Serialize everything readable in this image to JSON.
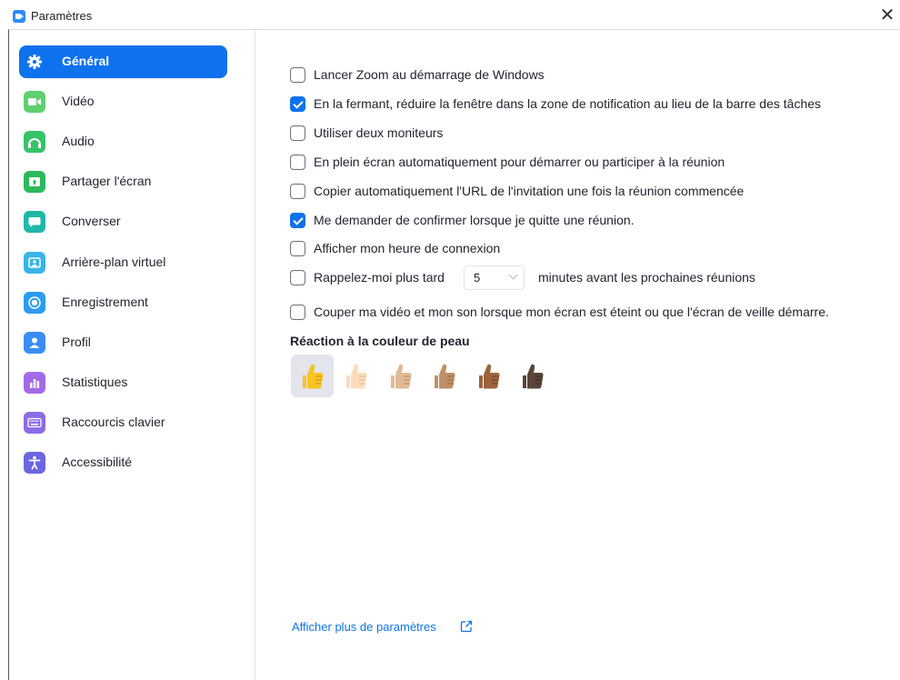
{
  "window": {
    "title": "Paramètres"
  },
  "sidebar": {
    "items": [
      {
        "label": "Général",
        "icon": "gear-icon",
        "color": "#0e72ed",
        "active": true
      },
      {
        "label": "Vidéo",
        "icon": "video-camera-icon",
        "color": "#5fcf70"
      },
      {
        "label": "Audio",
        "icon": "headphones-icon",
        "color": "#37c26a"
      },
      {
        "label": "Partager l'écran",
        "icon": "share-screen-icon",
        "color": "#2db85d"
      },
      {
        "label": "Converser",
        "icon": "chat-bubble-icon",
        "color": "#1fb8a8"
      },
      {
        "label": "Arrière-plan virtuel",
        "icon": "virtual-background-icon",
        "color": "#3ab4e8"
      },
      {
        "label": "Enregistrement",
        "icon": "record-icon",
        "color": "#2b9cf0"
      },
      {
        "label": "Profil",
        "icon": "profile-icon",
        "color": "#3a8df5"
      },
      {
        "label": "Statistiques",
        "icon": "statistics-icon",
        "color": "#a46be8"
      },
      {
        "label": "Raccourcis clavier",
        "icon": "keyboard-icon",
        "color": "#8c6ce6"
      },
      {
        "label": "Accessibilité",
        "icon": "accessibility-icon",
        "color": "#6b66e0"
      }
    ]
  },
  "general": {
    "options": [
      {
        "label": "Lancer Zoom au démarrage de Windows",
        "checked": false
      },
      {
        "label": "En la fermant, réduire la fenêtre dans la zone de notification au lieu de la barre des tâches",
        "checked": true
      },
      {
        "label": "Utiliser deux moniteurs",
        "checked": false
      },
      {
        "label": "En plein écran automatiquement pour démarrer ou participer à la réunion",
        "checked": false
      },
      {
        "label": "Copier automatiquement l'URL de l'invitation une fois la réunion commencée",
        "checked": false
      },
      {
        "label": "Me demander de confirmer lorsque je quitte une réunion.",
        "checked": true
      },
      {
        "label": "Afficher mon heure de connexion",
        "checked": false
      }
    ],
    "reminder": {
      "label": "Rappelez-moi plus tard",
      "checked": false,
      "value": "5",
      "suffix": "minutes avant les prochaines réunions"
    },
    "camera_off": {
      "label": "Couper ma vidéo et mon son lorsque mon écran est éteint ou que l'écran de veille démarre.",
      "checked": false
    },
    "skin_tone": {
      "title": "Réaction à la couleur de peau",
      "selected": 0,
      "tones": [
        "#f7c325",
        "#fadcbc",
        "#e0bb95",
        "#bf8f68",
        "#9b643d",
        "#594539"
      ]
    },
    "more_link": "Afficher plus de paramètres"
  },
  "colors": {
    "accent": "#0e72ed",
    "text": "#232333"
  }
}
